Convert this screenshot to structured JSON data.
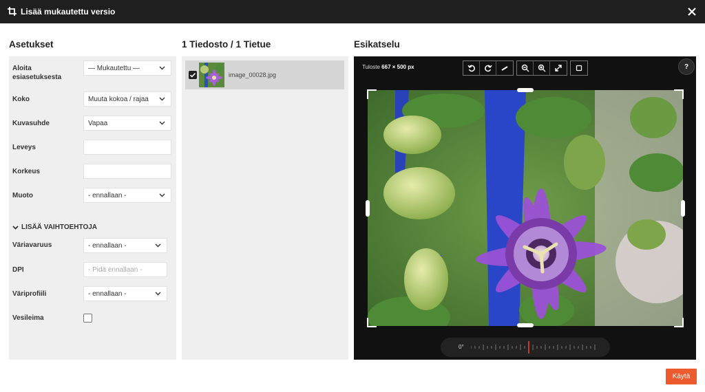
{
  "window": {
    "title": "Lisää mukautettu versio"
  },
  "settings": {
    "heading": "Asetukset",
    "fields": [
      {
        "label": "Aloita esiasetuksesta",
        "value": "— Mukautettu —"
      },
      {
        "label": "Koko",
        "value": "Muuta kokoa / rajaa"
      },
      {
        "label": "Kuvasuhde",
        "value": "Vapaa"
      },
      {
        "label": "Leveys",
        "value": ""
      },
      {
        "label": "Korkeus",
        "value": ""
      },
      {
        "label": "Muoto",
        "value": "- ennallaan -"
      }
    ],
    "more_label": "LISÄÄ VAIHTOEHTOJA",
    "more_fields": [
      {
        "label": "Väriavaruus",
        "value": "- ennallaan -"
      },
      {
        "label": "DPI",
        "placeholder": "- Pidä ennallaan -"
      },
      {
        "label": "Väriprofiili",
        "value": "- ennallaan -"
      },
      {
        "label": "Vesileima",
        "checked": false
      }
    ]
  },
  "files": {
    "heading": "1 Tiedosto / 1 Tietue",
    "items": [
      {
        "name": "image_00028.jpg",
        "checked": true
      }
    ]
  },
  "preview": {
    "heading": "Esikatselu",
    "output_label": "Tuloste",
    "output_size": "667 × 500 px",
    "help": "?",
    "rotation": "0°",
    "toolbar_icons": [
      "rotate-left-icon",
      "rotate-right-icon",
      "straighten-icon",
      "zoom-out-icon",
      "zoom-in-icon",
      "fit-icon",
      "crop-frame-icon"
    ]
  },
  "footer": {
    "apply_label": "Käytä",
    "apply_color": "#ec5a2d"
  }
}
